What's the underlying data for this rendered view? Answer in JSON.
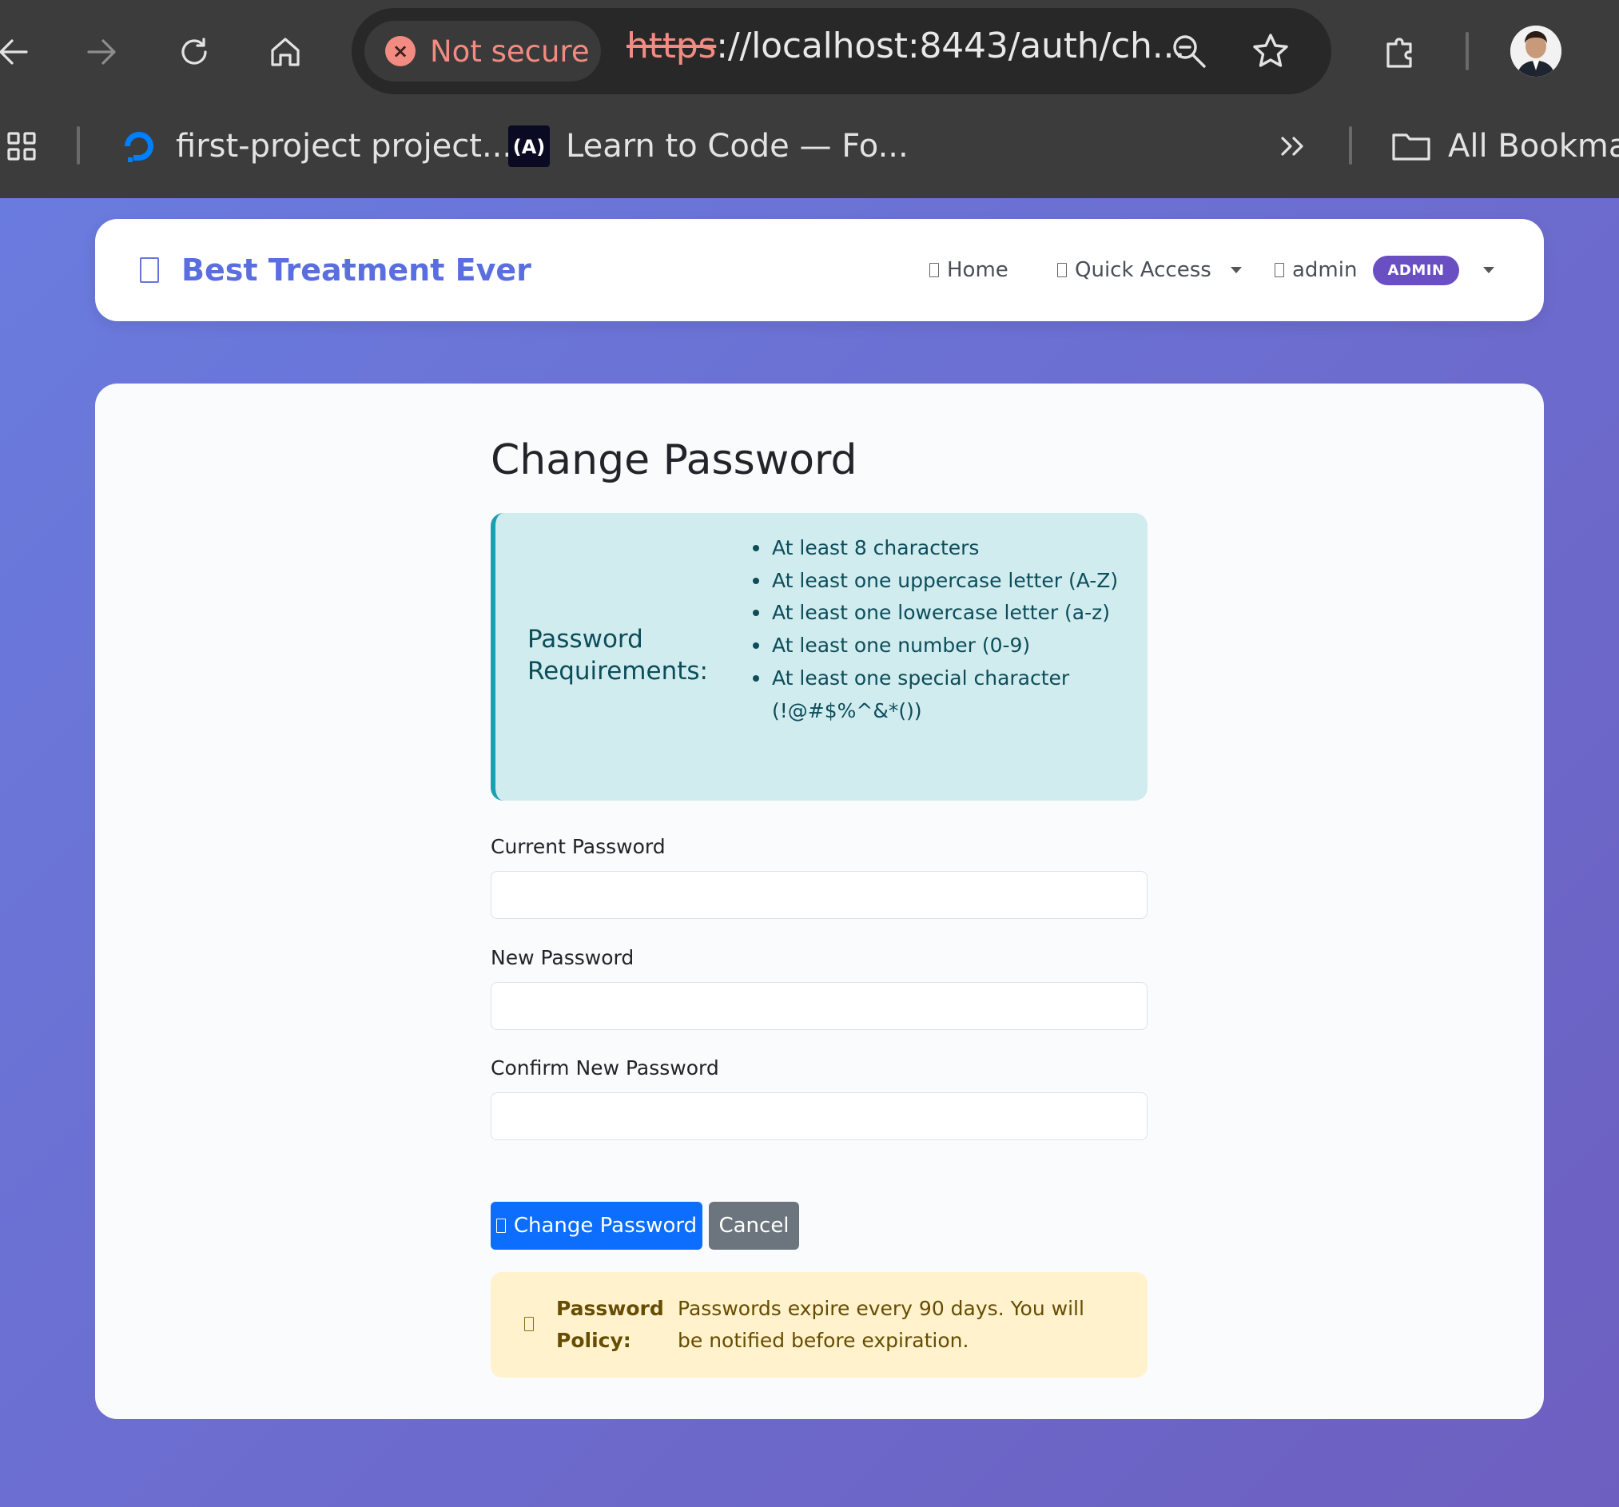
{
  "browser": {
    "security_label": "Not secure",
    "url_scheme": "https",
    "url_rest": "://localhost:8443/auth/ch...",
    "bookmarks": [
      {
        "label": "first-project project...",
        "icon": "digitalocean-icon"
      },
      {
        "label": "Learn to Code — Fo...",
        "icon": "freecodecamp-icon"
      }
    ],
    "all_bookmarks_label": "All Bookmar"
  },
  "navbar": {
    "brand": "Best Treatment Ever",
    "home_label": "Home",
    "quick_access_label": "Quick Access",
    "user_label": "admin",
    "role_badge": "ADMIN"
  },
  "main": {
    "title": "Change Password",
    "requirements": {
      "title_line1": "Password",
      "title_line2": "Requirements:",
      "items": [
        "At least 8 characters",
        "At least one uppercase letter (A-Z)",
        "At least one lowercase letter (a-z)",
        "At least one number (0-9)",
        "At least one special character (!@#$%^&*())"
      ]
    },
    "form": {
      "current_label": "Current Password",
      "new_label": "New Password",
      "confirm_label": "Confirm New Password",
      "submit_label": "Change Password",
      "cancel_label": "Cancel"
    },
    "policy": {
      "label": "Password Policy:",
      "text": "Passwords expire every 90 days. You will be notified before expiration."
    }
  },
  "colors": {
    "brand": "#5a6ee0",
    "primary": "#0d6efd",
    "secondary": "#6c757d",
    "info_bg": "#d1ecef",
    "warning_bg": "#fff2cc",
    "admin_badge": "#6a4fc2"
  }
}
